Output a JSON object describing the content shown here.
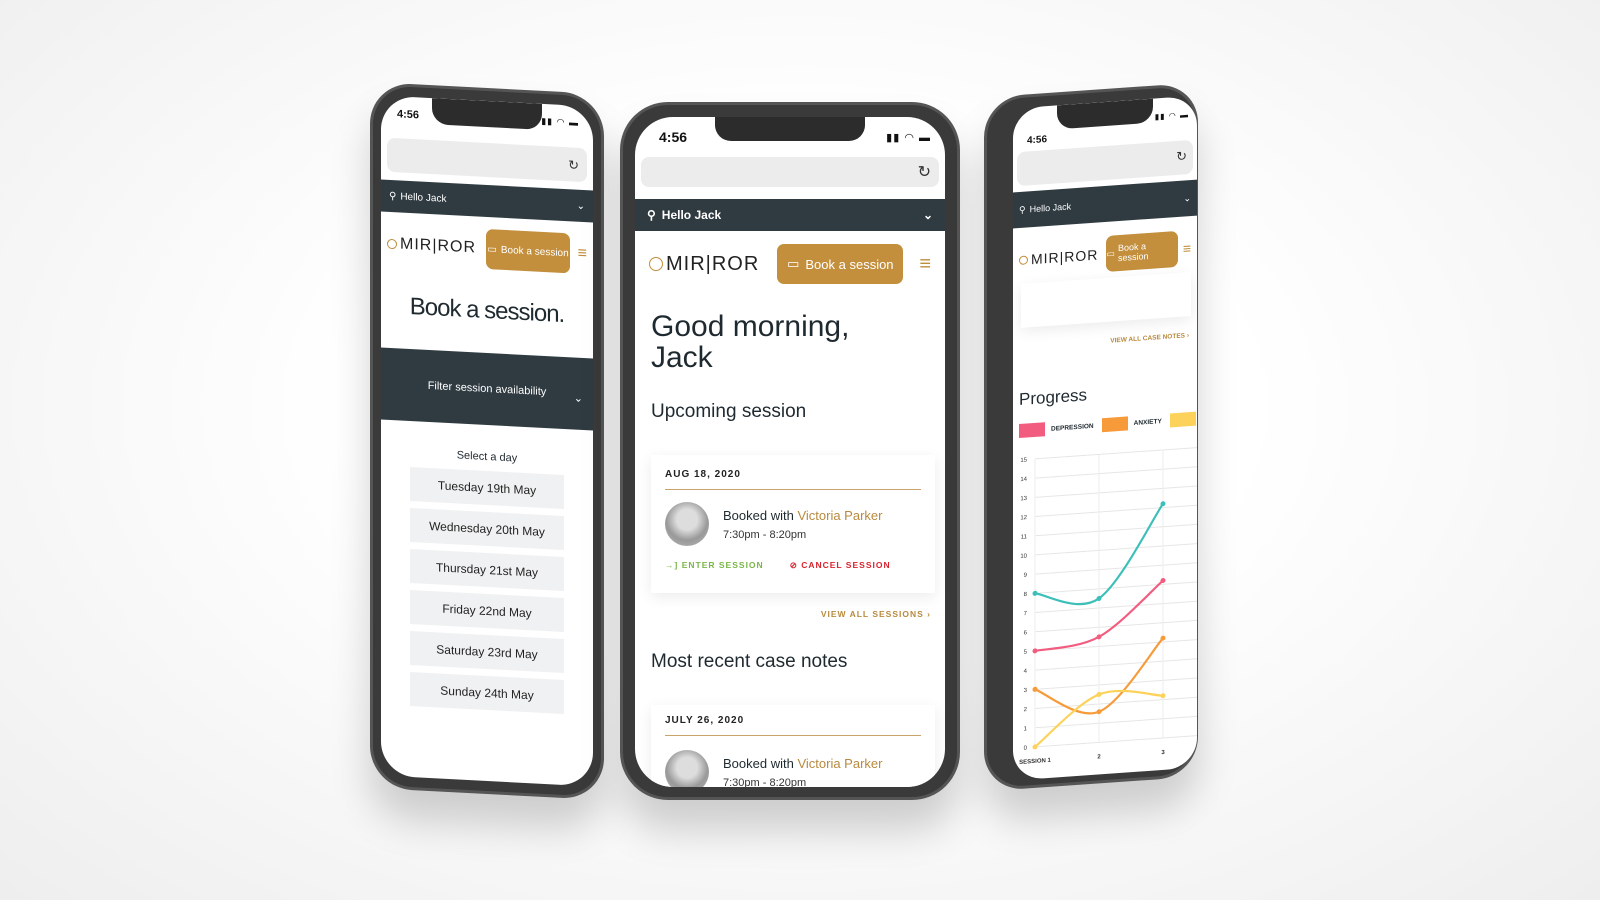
{
  "status_time": "4:56",
  "greeting": "Hello Jack",
  "logo_text": "MIR|ROR",
  "book_button": "Book a session",
  "colors": {
    "gold": "#c38f3d",
    "dark": "#2f3b41",
    "enter": "#7ab648",
    "cancel": "#d9232e",
    "teal": "#3bbfb8",
    "pink": "#f25c7f",
    "orange": "#f79a3a",
    "yellow": "#fcd25a"
  },
  "left": {
    "title": "Book a session.",
    "filter": "Filter session availability",
    "select_label": "Select a day",
    "days": [
      "Tuesday 19th May",
      "Wednesday 20th May",
      "Thursday 21st May",
      "Friday 22nd May",
      "Saturday 23rd May",
      "Sunday 24th May"
    ]
  },
  "center": {
    "heading_line1": "Good morning,",
    "heading_line2": "Jack",
    "upcoming_title": "Upcoming session",
    "upcoming": {
      "date": "AUG 18, 2020",
      "booked_with": "Booked with",
      "therapist": "Victoria Parker",
      "time": "7:30pm - 8:20pm",
      "enter": "ENTER SESSION",
      "cancel": "CANCEL SESSION"
    },
    "view_all_sessions": "VIEW ALL SESSIONS",
    "notes_title": "Most recent case notes",
    "note": {
      "date": "JULY 26, 2020",
      "booked_with": "Booked with",
      "therapist": "Victoria Parker",
      "time": "7:30pm - 8:20pm"
    }
  },
  "right": {
    "view_all_notes": "VIEW ALL CASE NOTES",
    "progress_title": "Progress"
  },
  "chart_data": {
    "type": "line",
    "title": "Progress",
    "categories": [
      "SESSION 1",
      "2",
      "3"
    ],
    "ylim": [
      0,
      15
    ],
    "yticks": [
      0,
      1,
      2,
      3,
      4,
      5,
      6,
      7,
      8,
      9,
      10,
      11,
      12,
      13,
      14,
      15
    ],
    "grid": true,
    "legend_position": "top",
    "series": [
      {
        "name": "DEPRESSION",
        "color": "#f25c7f",
        "values": [
          5,
          5.5,
          8.2
        ]
      },
      {
        "name": "ANXIETY",
        "color": "#f79a3a",
        "values": [
          3,
          1.6,
          5.2
        ]
      },
      {
        "color": "#fcd25a",
        "values": [
          0,
          2.5,
          2.2
        ]
      },
      {
        "color": "#3bbfb8",
        "values": [
          8,
          7.5,
          12.2
        ]
      }
    ]
  }
}
